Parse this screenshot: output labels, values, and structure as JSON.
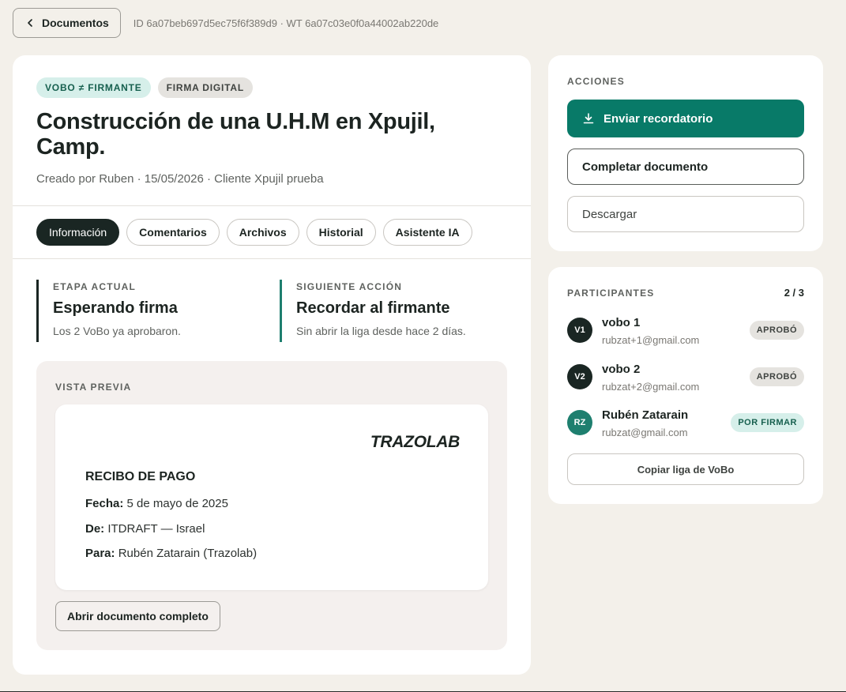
{
  "topbar": {
    "back_label": "Documentos",
    "ids": "ID 6a07beb697d5ec75f6f389d9 · WT 6a07c03e0f0a44002ab220de"
  },
  "document": {
    "badges": [
      "VOBO ≠ FIRMANTE",
      "FIRMA DIGITAL"
    ],
    "title": "Construcción de una U.H.M en Xpujil, Camp.",
    "meta": "Creado por Ruben · 15/05/2026 · Cliente Xpujil prueba"
  },
  "tabs": [
    "Información",
    "Comentarios",
    "Archivos",
    "Historial",
    "Asistente IA"
  ],
  "stage": {
    "current_label": "ETAPA ACTUAL",
    "current_value": "Esperando firma",
    "current_note": "Los 2 VoBo ya aprobaron.",
    "next_label": "SIGUIENTE ACCIÓN",
    "next_value": "Recordar al firmante",
    "next_note": "Sin abrir la liga desde hace 2 días."
  },
  "preview": {
    "label": "VISTA PREVIA",
    "brand": "TRAZOLAB",
    "receipt_title": "RECIBO DE PAGO",
    "fecha_label": "Fecha:",
    "fecha_value": "5 de mayo de 2025",
    "de_label": "De:",
    "de_value": "ITDRAFT — Israel",
    "para_label": "Para:",
    "para_value": "Rubén Zatarain (Trazolab)",
    "open_label": "Abrir documento completo"
  },
  "actions": {
    "label": "ACCIONES",
    "remind": "Enviar recordatorio",
    "complete": "Completar documento",
    "download": "Descargar"
  },
  "participants": {
    "label": "PARTICIPANTES",
    "count": "2 / 3",
    "list": [
      {
        "initials": "V1",
        "name": "vobo 1",
        "email": "rubzat+1@gmail.com",
        "status": "APROBÓ"
      },
      {
        "initials": "V2",
        "name": "vobo 2",
        "email": "rubzat+2@gmail.com",
        "status": "APROBÓ"
      },
      {
        "initials": "RZ",
        "name": "Rubén Zatarain",
        "email": "rubzat@gmail.com",
        "status": "POR FIRMAR"
      }
    ],
    "copy_label": "Copiar liga de VoBo"
  },
  "colors": {
    "accent": "#087a68",
    "dark": "#1a2623",
    "background": "#f3f0ea",
    "badge_teal_bg": "#d6efea"
  },
  "icons": {
    "back": "chevron-left-icon",
    "remind": "download-icon"
  }
}
